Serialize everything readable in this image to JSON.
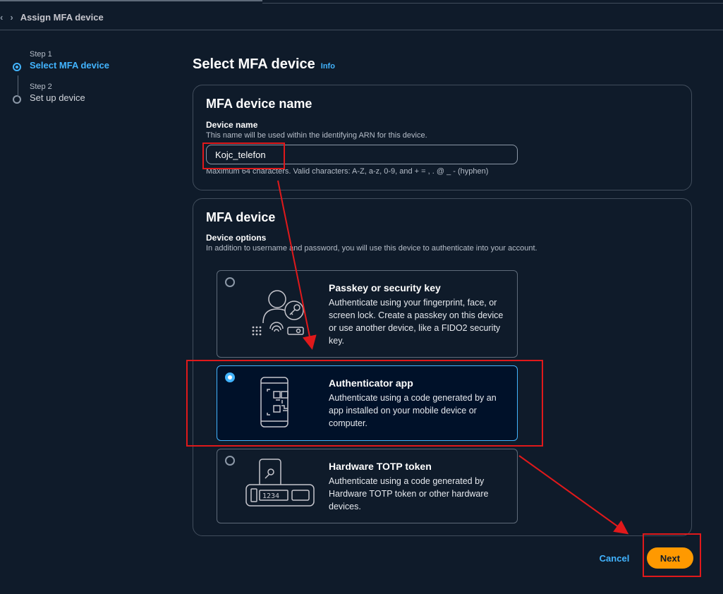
{
  "breadcrumb": {
    "current": "Assign MFA device"
  },
  "steps": [
    {
      "number": "Step 1",
      "title": "Select MFA device",
      "active": true
    },
    {
      "number": "Step 2",
      "title": "Set up device",
      "active": false
    }
  ],
  "page": {
    "title": "Select MFA device",
    "info": "Info"
  },
  "name_card": {
    "heading": "MFA device name",
    "label": "Device name",
    "description": "This name will be used within the identifying ARN for this device.",
    "value": "Kojc_telefon",
    "hint": "Maximum 64 characters. Valid characters: A-Z, a-z, 0-9, and + = , . @ _ - (hyphen)"
  },
  "device_card": {
    "heading": "MFA device",
    "label": "Device options",
    "description": "In addition to username and password, you will use this device to authenticate into your account.",
    "options": [
      {
        "title": "Passkey or security key",
        "description": "Authenticate using your fingerprint, face, or screen lock. Create a passkey on this device or use another device, like a FIDO2 security key.",
        "selected": false,
        "icon": "passkey-illustration-icon"
      },
      {
        "title": "Authenticator app",
        "description": "Authenticate using a code generated by an app installed on your mobile device or computer.",
        "selected": true,
        "icon": "authenticator-app-illustration-icon"
      },
      {
        "title": "Hardware TOTP token",
        "description": "Authenticate using a code generated by Hardware TOTP token or other hardware devices.",
        "selected": false,
        "icon": "hardware-token-illustration-icon",
        "token_display": "1234"
      }
    ]
  },
  "actions": {
    "cancel": "Cancel",
    "next": "Next"
  },
  "colors": {
    "background": "#0f1b2a",
    "accent": "#42b4ff",
    "primary_button": "#ff9900",
    "annotation": "#e0191b"
  }
}
